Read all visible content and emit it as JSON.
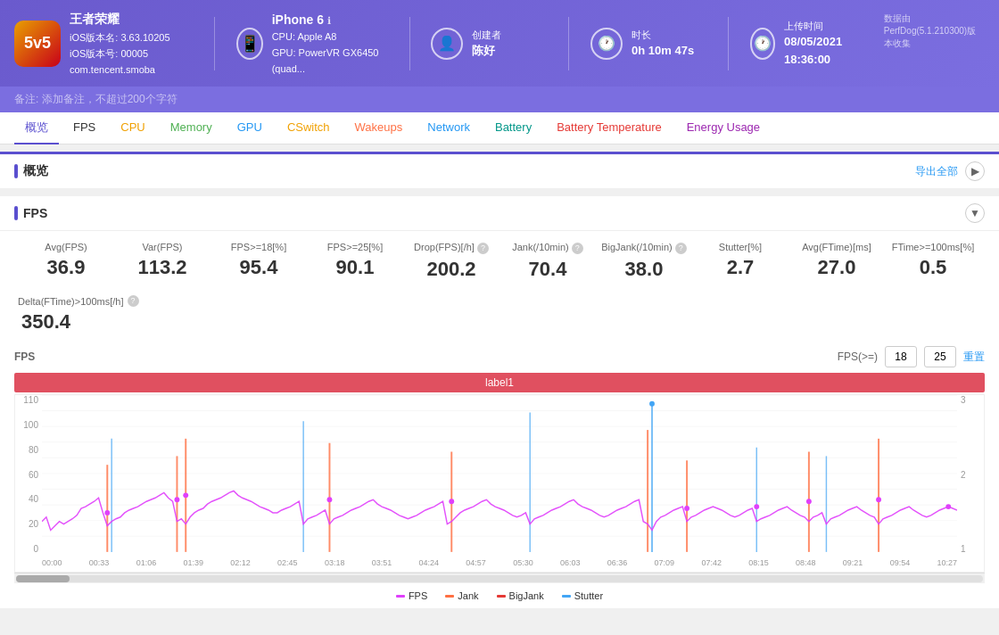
{
  "header": {
    "version_note": "数据由PerfDog(5.1.210300)版本收集",
    "app": {
      "name": "王者荣耀",
      "ios_version": "iOS版本名: 3.63.10205",
      "ios_build": "iOS版本号: 00005",
      "bundle": "com.tencent.smoba"
    },
    "device": {
      "name": "iPhone 6",
      "cpu": "CPU: Apple A8",
      "gpu": "GPU: PowerVR GX6450 (quad..."
    },
    "creator": {
      "label": "创建者",
      "value": "陈好"
    },
    "duration": {
      "label": "时长",
      "value": "0h 10m 47s"
    },
    "upload": {
      "label": "上传时间",
      "value": "08/05/2021 18:36:00"
    }
  },
  "notes": {
    "placeholder": "备注: 添加备注，不超过200个字符"
  },
  "tabs": [
    {
      "label": "概览",
      "color": "default",
      "active": true
    },
    {
      "label": "FPS",
      "color": "default"
    },
    {
      "label": "CPU",
      "color": "yellow"
    },
    {
      "label": "Memory",
      "color": "green"
    },
    {
      "label": "GPU",
      "color": "blue"
    },
    {
      "label": "CSwitch",
      "color": "yellow"
    },
    {
      "label": "Wakeups",
      "color": "orange"
    },
    {
      "label": "Network",
      "color": "blue"
    },
    {
      "label": "Battery",
      "color": "teal"
    },
    {
      "label": "Battery Temperature",
      "color": "red"
    },
    {
      "label": "Energy Usage",
      "color": "purple"
    }
  ],
  "overview": {
    "title": "概览",
    "export_label": "导出全部"
  },
  "fps": {
    "title": "FPS",
    "stats": [
      {
        "label": "Avg(FPS)",
        "value": "36.9"
      },
      {
        "label": "Var(FPS)",
        "value": "113.2"
      },
      {
        "label": "FPS>=18[%]",
        "value": "95.4"
      },
      {
        "label": "FPS>=25[%]",
        "value": "90.1"
      },
      {
        "label": "Drop(FPS)[/h]",
        "value": "200.2",
        "has_help": true
      },
      {
        "label": "Jank(/10min)",
        "value": "70.4",
        "has_help": true
      },
      {
        "label": "BigJank(/10min)",
        "value": "38.0",
        "has_help": true
      },
      {
        "label": "Stutter[%]",
        "value": "2.7"
      },
      {
        "label": "Avg(FTime)[ms]",
        "value": "27.0"
      },
      {
        "label": "FTime>=100ms[%]",
        "value": "0.5"
      }
    ],
    "delta": {
      "label": "Delta(FTime)>100ms[/h]",
      "value": "350.4",
      "has_help": true
    },
    "chart": {
      "y_axis_left": [
        "110",
        "100",
        "80",
        "60",
        "40",
        "20",
        "0"
      ],
      "y_axis_right": [
        "3",
        "2",
        "1"
      ],
      "x_axis": [
        "00:00",
        "00:33",
        "01:06",
        "01:39",
        "02:12",
        "02:45",
        "03:18",
        "03:51",
        "04:24",
        "04:57",
        "05:30",
        "06:03",
        "06:36",
        "07:09",
        "07:42",
        "08:15",
        "08:48",
        "09:21",
        "09:54",
        "10:27"
      ],
      "label_bar": "label1",
      "threshold_label": "FPS(>=)",
      "threshold_1": "18",
      "threshold_2": "25",
      "reset_label": "重置",
      "fps_label": "FPS",
      "jank_label": "Jank"
    },
    "legend": [
      {
        "label": "FPS",
        "color": "#e040fb"
      },
      {
        "label": "Jank",
        "color": "#ff7043"
      },
      {
        "label": "BigJank",
        "color": "#e53935"
      },
      {
        "label": "Stutter",
        "color": "#42a5f5"
      }
    ]
  }
}
